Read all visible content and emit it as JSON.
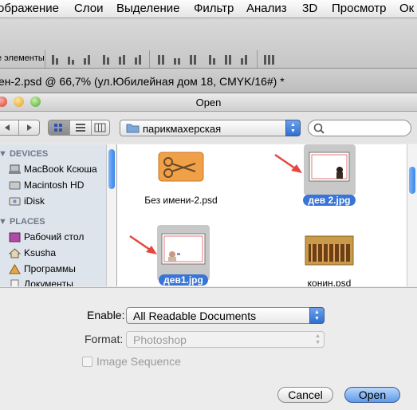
{
  "menubar": {
    "items": [
      "ображение",
      "Слои",
      "Выделение",
      "Фильтр",
      "Анализ",
      "3D",
      "Просмотр",
      "Ок"
    ]
  },
  "options_bar": {
    "label": "е элементы"
  },
  "document_tab": {
    "title": "ен-2.psd @ 66,7% (ул.Юбилейная дом 18, CMYK/16#) *"
  },
  "dialog": {
    "title": "Open",
    "location": "парикмахерская",
    "search_placeholder": "",
    "sidebar": {
      "devices_heading": "DEVICES",
      "devices": [
        "MacBook Ксюша",
        "Macintosh HD",
        "iDisk"
      ],
      "places_heading": "PLACES",
      "places": [
        "Рабочий стол",
        "Ksusha",
        "Программы",
        "Документы"
      ]
    },
    "files": [
      {
        "name": "Без имени-2.psd",
        "selected": false
      },
      {
        "name": "дев 2.jpg",
        "selected": true
      },
      {
        "name": "дев1.jpg",
        "selected": true
      },
      {
        "name": "конин.psd",
        "selected": false
      }
    ],
    "enable_label": "Enable:",
    "enable_value": "All Readable Documents",
    "format_label": "Format:",
    "format_value": "Photoshop",
    "image_sequence_label": "Image Sequence",
    "image_sequence_checked": false,
    "cancel_label": "Cancel",
    "open_label": "Open"
  },
  "colors": {
    "accent": "#3875d7",
    "sidebar_bg": "#dde4ec",
    "arrow": "#e8453c"
  }
}
